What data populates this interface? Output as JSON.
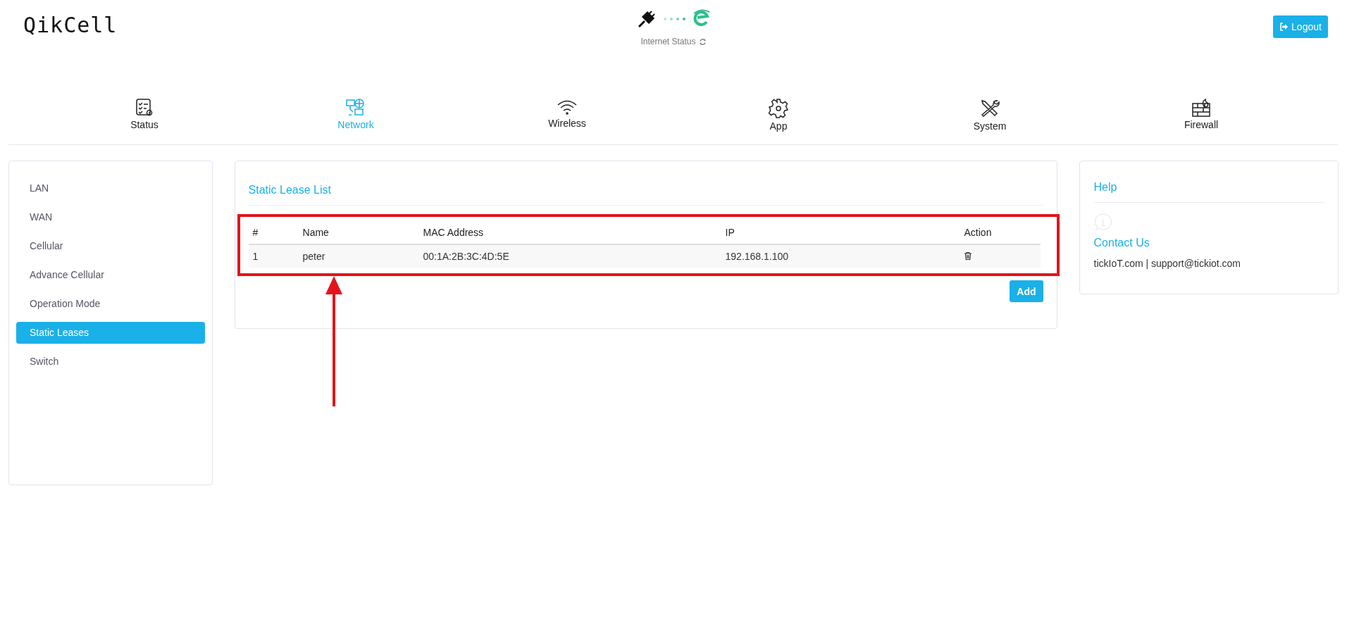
{
  "header": {
    "logo": "QikCell",
    "internet_status": "Internet Status",
    "logout": "Logout"
  },
  "nav": [
    {
      "label": "Status",
      "selected": false
    },
    {
      "label": "Network",
      "selected": true
    },
    {
      "label": "Wireless",
      "selected": false
    },
    {
      "label": "App",
      "selected": false
    },
    {
      "label": "System",
      "selected": false
    },
    {
      "label": "Firewall",
      "selected": false
    }
  ],
  "sidebar": {
    "items": [
      {
        "label": "LAN",
        "selected": false
      },
      {
        "label": "WAN",
        "selected": false
      },
      {
        "label": "Cellular",
        "selected": false
      },
      {
        "label": "Advance Cellular",
        "selected": false
      },
      {
        "label": "Operation Mode",
        "selected": false
      },
      {
        "label": "Static Leases",
        "selected": true
      },
      {
        "label": "Switch",
        "selected": false
      }
    ]
  },
  "main": {
    "title": "Static Lease List",
    "table": {
      "columns": [
        "#",
        "Name",
        "MAC Address",
        "IP",
        "Action"
      ],
      "rows": [
        [
          "1",
          "peter",
          "00:1A:2B:3C:4D:5E",
          "192.168.1.100"
        ]
      ]
    },
    "add_button": "Add"
  },
  "help": {
    "title": "Help",
    "contact_title": "Contact Us",
    "contact_text": "tickIoT.com | support@tickiot.com"
  }
}
